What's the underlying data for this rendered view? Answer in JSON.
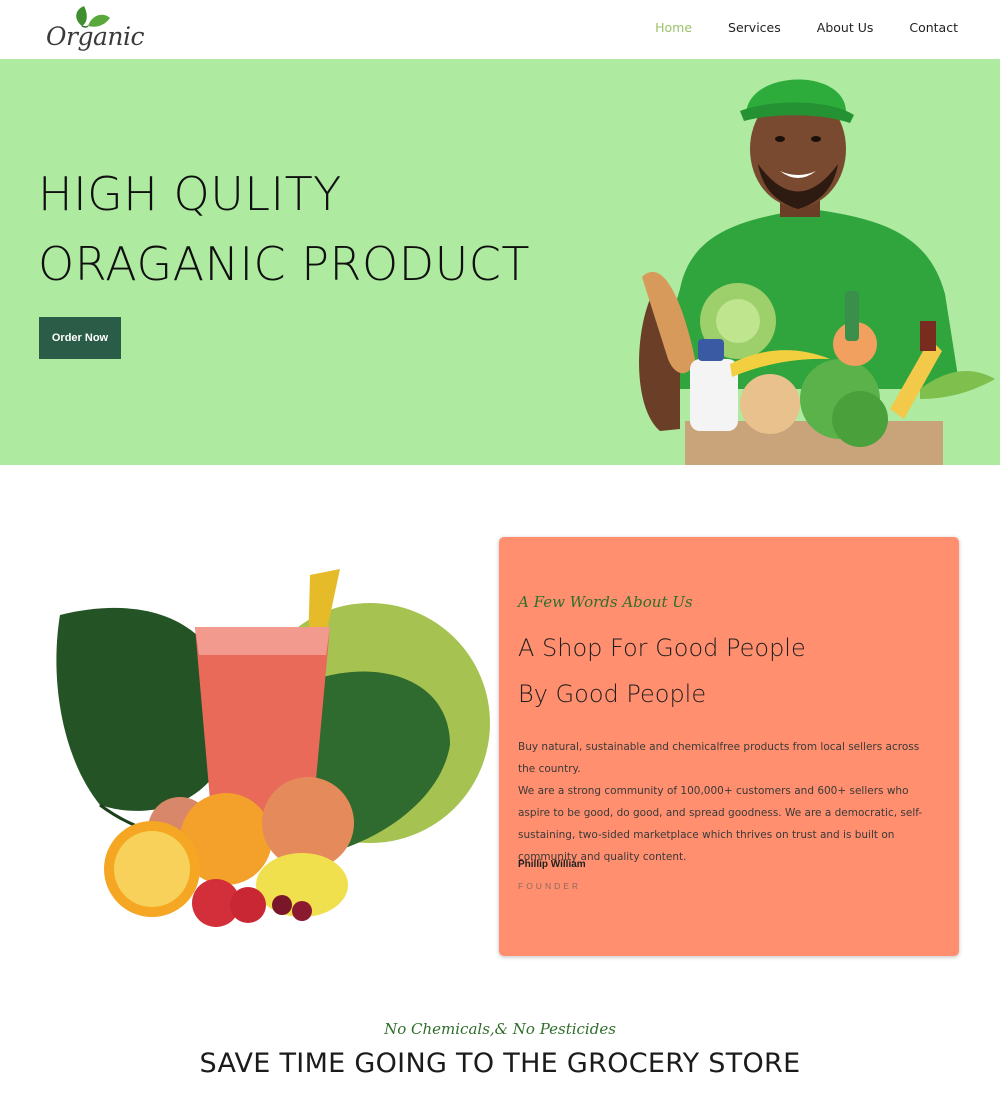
{
  "logo": {
    "text": "Organic"
  },
  "nav": {
    "items": [
      {
        "label": "Home",
        "active": true
      },
      {
        "label": "Services",
        "active": false
      },
      {
        "label": "About Us",
        "active": false
      },
      {
        "label": "Contact",
        "active": false
      }
    ]
  },
  "hero": {
    "title_line1": "HIGH QULITY",
    "title_line2": "ORAGANIC PRODUCT",
    "button_label": "Order Now",
    "background": "#aeeaa0",
    "button_color": "#2a5c48"
  },
  "about": {
    "subtitle": "A Few Words About Us",
    "title_line1": "A Shop For Good People",
    "title_line2": "By Good People",
    "paragraph1": "Buy natural, sustainable and chemicalfree products from local sellers across the country.",
    "paragraph2": "We are a strong community of 100,000+ customers and 600+ sellers who aspire to be good, do good, and spread goodness. We are a democratic, self-sustaining, two-sided marketplace which thrives on trust and is built on community and quality content.",
    "author": "Phillip William",
    "role": "FOUNDER",
    "card_color": "#ff8f6e"
  },
  "section": {
    "subtitle": "No Chemicals,& No Pesticides",
    "title": "SAVE TIME GOING TO THE GROCERY STORE"
  }
}
